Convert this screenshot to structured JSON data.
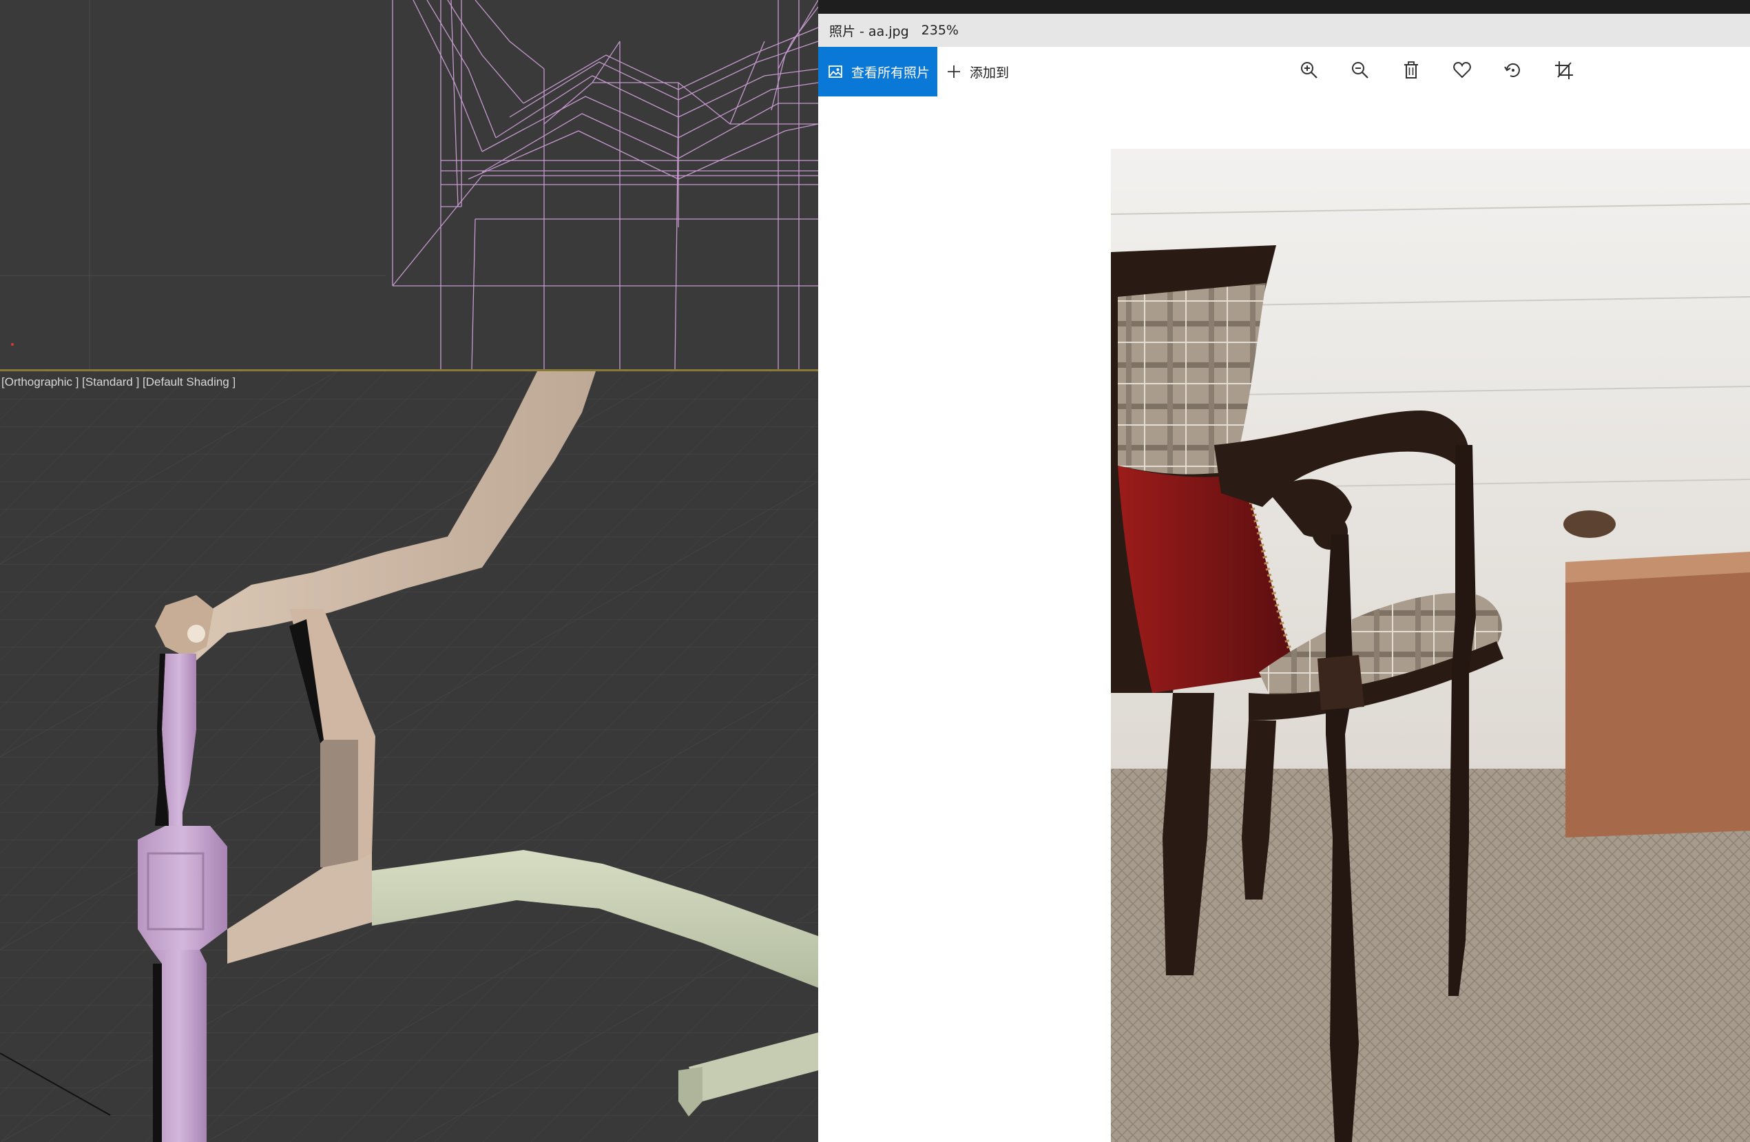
{
  "viewport": {
    "perspective_label": "[Orthographic ] [Standard ] [Default Shading ]"
  },
  "photos_app": {
    "title": "照片 - aa.jpg",
    "zoom": "235%",
    "toolbar": {
      "view_all_photos": "查看所有照片",
      "add_to": "添加到",
      "icons": [
        "zoom-in-icon",
        "zoom-out-icon",
        "delete-icon",
        "favorite-icon",
        "rotate-icon",
        "crop-icon"
      ]
    },
    "image_description_icon": "photo-icon"
  },
  "colors": {
    "accent": "#0a78d7",
    "viewport_bg": "#393939",
    "wire_pink": "#c79ad0",
    "model_beige": "#cfb9a4",
    "model_green": "#c9d1b6",
    "model_lilac": "#c7a6cf"
  }
}
